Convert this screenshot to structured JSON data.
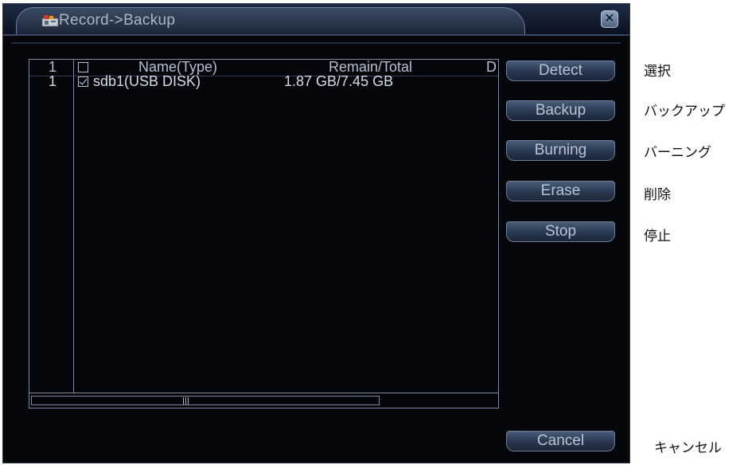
{
  "window": {
    "title": "Record->Backup",
    "close_icon": "close-icon"
  },
  "table": {
    "headers": {
      "index": "1",
      "name": "Name(Type)",
      "remain_total": "Remain/Total",
      "d": "D"
    },
    "rows": [
      {
        "index": "1",
        "checked": true,
        "name": "sdb1(USB DISK)",
        "remain_total": "1.87 GB/7.45 GB"
      }
    ]
  },
  "buttons": {
    "detect": "Detect",
    "backup": "Backup",
    "burning": "Burning",
    "erase": "Erase",
    "stop": "Stop",
    "cancel": "Cancel"
  },
  "annotations": {
    "detect": "選択",
    "backup": "バックアップ",
    "burning": "バーニング",
    "erase": "削除",
    "stop": "停止",
    "cancel": "キャンセル"
  },
  "colors": {
    "background": "#05070b",
    "text": "#b3c0d3",
    "border": "#7c8aa3",
    "accent": "#6b7d99"
  }
}
